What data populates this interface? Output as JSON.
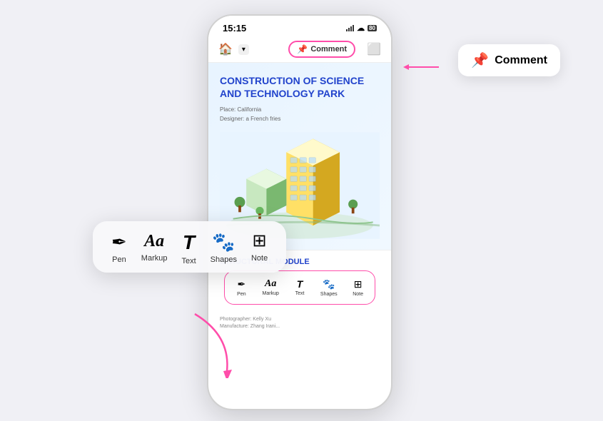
{
  "phone": {
    "status_time": "15:15",
    "nav": {
      "home_icon": "🏠",
      "chevron": "▾",
      "comment_label": "Comment",
      "comment_icon": "📌",
      "export_icon": "⤓"
    },
    "document": {
      "title_line1": "CONSTRUCTION OF SCIENCE",
      "title_line2": "AND TECHNOLOGY PARK",
      "meta_place": "Place: California",
      "meta_designer": "Designer: a French fries",
      "section_title": "STRUCTURAL MODULE",
      "footer_line1": "Photographer: Kelly Xu",
      "footer_line2": "Manufacture: Zhang Irani..."
    },
    "phone_toolbar": {
      "items": [
        {
          "icon": "✒",
          "label": "Pen"
        },
        {
          "icon": "Aa",
          "label": "Markup"
        },
        {
          "icon": "𝒯",
          "label": "Text"
        },
        {
          "icon": "♣",
          "label": "Shapes"
        },
        {
          "icon": "▦",
          "label": "Note"
        }
      ]
    }
  },
  "floating_toolbar": {
    "items": [
      {
        "icon": "✒",
        "label": "Pen"
      },
      {
        "icon": "Aa",
        "label": "Markup"
      },
      {
        "icon": "𝒯",
        "label": "Text"
      },
      {
        "icon": "♣",
        "label": "Shapes"
      },
      {
        "icon": "▦",
        "label": "Note"
      }
    ]
  },
  "comment_tooltip": {
    "icon": "📌",
    "label": "Comment"
  }
}
